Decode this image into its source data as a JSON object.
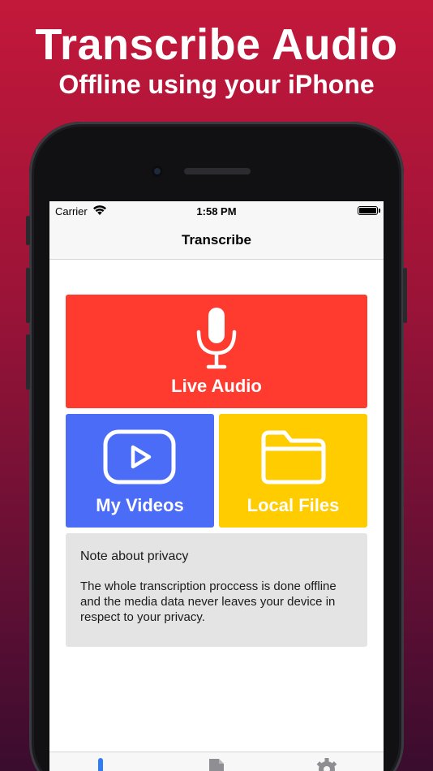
{
  "promo": {
    "headline": "Transcribe Audio",
    "subheadline": "Offline using your iPhone"
  },
  "status_bar": {
    "carrier": "Carrier",
    "time": "1:58 PM"
  },
  "navigation": {
    "title": "Transcribe"
  },
  "tiles": [
    {
      "label": "Live Audio",
      "icon": "microphone-icon",
      "color": "#ff3b30"
    },
    {
      "label": "My Videos",
      "icon": "video-play-icon",
      "color": "#4a6cf7"
    },
    {
      "label": "Local Files",
      "icon": "folder-icon",
      "color": "#ffcc00"
    }
  ],
  "privacy_note": {
    "title": "Note about privacy",
    "body": "The whole transcription proccess is done offline and the media data never leaves your device in respect to your privacy."
  },
  "tab_bar": {
    "items": [
      {
        "icon": "microphone-tab-icon",
        "selected": true,
        "color": "#2f7cf6"
      },
      {
        "icon": "document-tab-icon",
        "selected": false,
        "color": "#8e8e93"
      },
      {
        "icon": "gear-tab-icon",
        "selected": false,
        "color": "#8e8e93"
      }
    ]
  },
  "colors": {
    "background_top": "#c3183a",
    "background_bottom": "#3a0c2e",
    "accent": "#2f7cf6"
  }
}
